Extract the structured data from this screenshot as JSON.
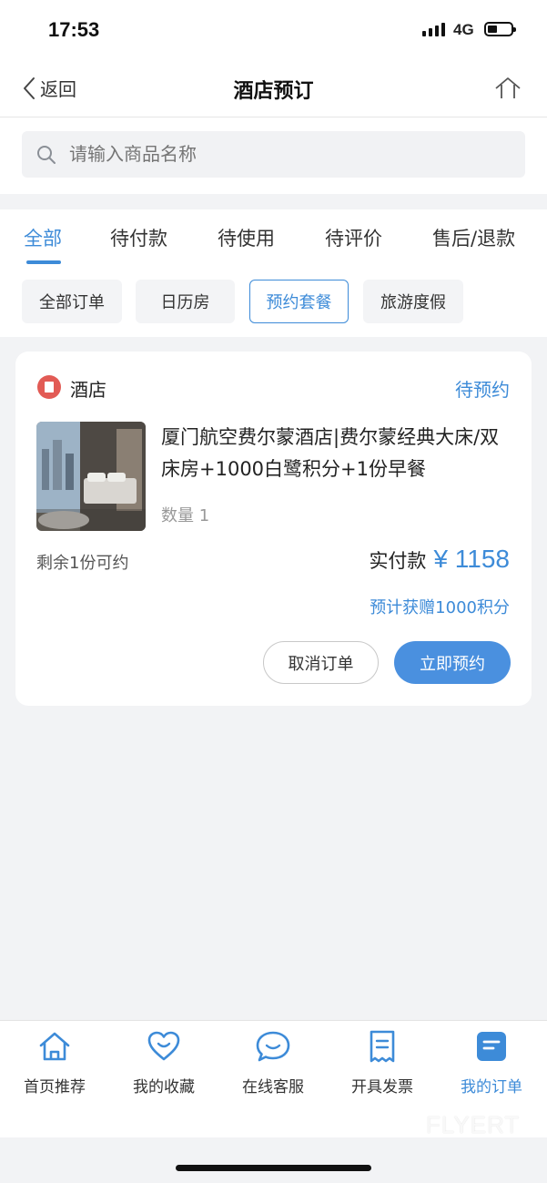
{
  "status_bar": {
    "time": "17:53",
    "network": "4G"
  },
  "nav": {
    "back_label": "返回",
    "title": "酒店预订"
  },
  "search": {
    "placeholder": "请输入商品名称"
  },
  "tabs": [
    {
      "label": "全部",
      "active": true
    },
    {
      "label": "待付款"
    },
    {
      "label": "待使用"
    },
    {
      "label": "待评价"
    },
    {
      "label": "售后/退款"
    }
  ],
  "filters": [
    {
      "label": "全部订单"
    },
    {
      "label": "日历房"
    },
    {
      "label": "预约套餐",
      "active": true
    },
    {
      "label": "旅游度假"
    }
  ],
  "order": {
    "category": "酒店",
    "status": "待预约",
    "title": "厦门航空费尔蒙酒店|费尔蒙经典大床/双床房+1000白鹭积分+1份早餐",
    "quantity": "数量 1",
    "remaining": "剩余1份可约",
    "paid_label": "实付款",
    "paid_amount": "¥ 1158",
    "points": "预计获赠1000积分",
    "cancel_label": "取消订单",
    "book_label": "立即预约"
  },
  "tabbar": [
    {
      "label": "首页推荐",
      "icon": "home-icon"
    },
    {
      "label": "我的收藏",
      "icon": "heart-icon"
    },
    {
      "label": "在线客服",
      "icon": "chat-icon"
    },
    {
      "label": "开具发票",
      "icon": "receipt-icon"
    },
    {
      "label": "我的订单",
      "icon": "order-icon",
      "active": true
    }
  ],
  "watermark": "FLYERT",
  "colors": {
    "accent": "#3d8bd8",
    "button": "#4a90df",
    "badge": "#e25b55"
  }
}
